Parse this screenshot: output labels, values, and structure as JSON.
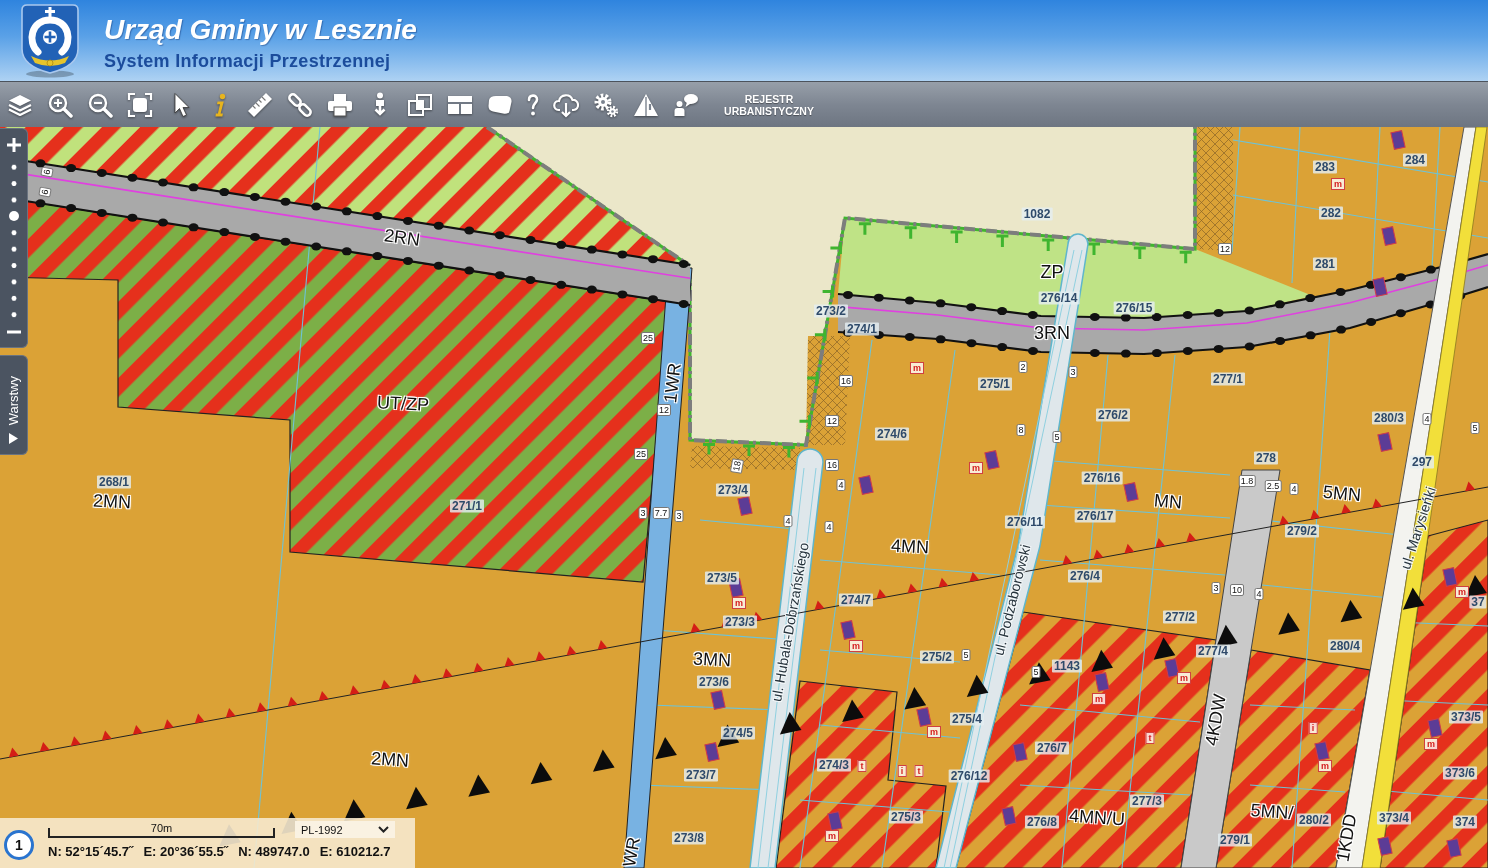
{
  "header": {
    "title": "Urząd Gminy w Lesznie",
    "subtitle": "System Informacji Przestrzennej"
  },
  "toolbar": {
    "register_button": "REJESTR URBANISTYCZNY"
  },
  "zoom_slider": {
    "level": 0.67
  },
  "layers_tab": {
    "label": "Warstwy"
  },
  "map": {
    "zone_labels": [
      "2RN",
      "ZP",
      "3RN",
      "UT/ZP",
      "1WR",
      "2MN",
      "MN",
      "5MN",
      "4MN",
      "3MN",
      "4KDW",
      "2MN",
      "4MN/U",
      "5MN/",
      "WR",
      "1KDD"
    ],
    "street_labels": [
      "ul. Hubala-Dobrzańskiego",
      "ul. Podzaborowski",
      "ul. Marysieńki"
    ],
    "parcel_labels": [
      "283",
      "284",
      "1082",
      "282",
      "281",
      "273/2",
      "276/14",
      "276/15",
      "274/1",
      "275/1",
      "277/1",
      "276/2",
      "280/3",
      "274/6",
      "278",
      "297",
      "268/1",
      "273/4",
      "276/16",
      "271/1",
      "276/11",
      "276/17",
      "279/2",
      "273/5",
      "276/4",
      "274/7",
      "37",
      "273/3",
      "277/2",
      "275/2",
      "277/4",
      "280/4",
      "1143",
      "273/6",
      "275/4",
      "373/5",
      "274/5",
      "276/7",
      "273/7",
      "274/3",
      "276/12",
      "373/6",
      "277/3",
      "275/3",
      "276/8",
      "280/2",
      "373/4",
      "374",
      "273/8",
      "279/1"
    ],
    "dimension_labels": [
      "6",
      "6",
      "12",
      "25",
      "2",
      "16",
      "3",
      "12",
      "12",
      "8",
      "4",
      "5",
      "5",
      "25",
      "18",
      "16",
      "4",
      "1.8",
      "2.5",
      "4",
      "3",
      "7.7",
      "3",
      "4",
      "4",
      "3",
      "10",
      "4",
      "5",
      "5"
    ],
    "building_marks": [
      "m",
      "m",
      "m",
      "m",
      "m",
      "m",
      "m",
      "m",
      "m",
      "t",
      "i",
      "m",
      "t",
      "i",
      "t",
      "m",
      "m"
    ]
  },
  "status_bar": {
    "badge": "1",
    "scale_label": "70m",
    "crs": "PL-1992",
    "coordinates": [
      "N: 52°15´45.7˝",
      "E: 20°36´55.5˝",
      "N: 489747.0",
      "E: 610212.7"
    ]
  }
}
